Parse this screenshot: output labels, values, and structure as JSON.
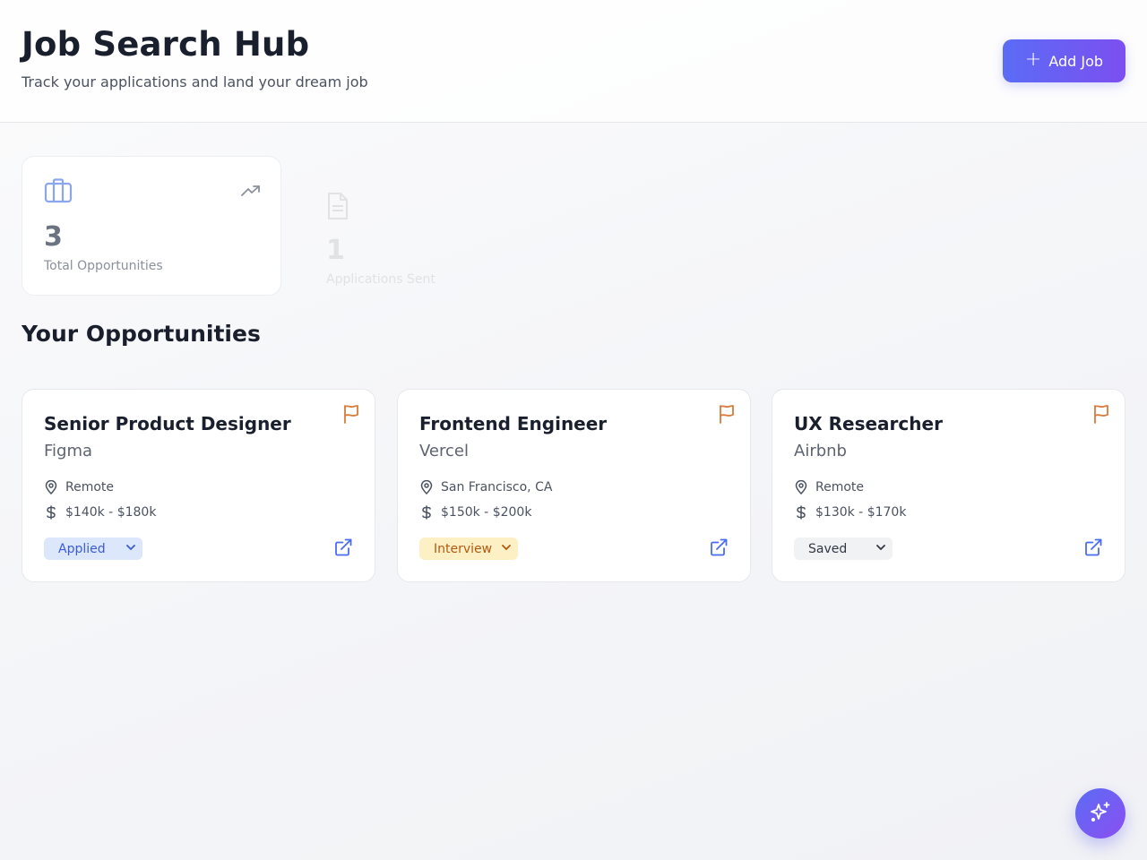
{
  "header": {
    "title": "Job Search Hub",
    "subtitle": "Track your applications and land your dream job",
    "add_button_label": "Add Job",
    "add_button_icon": "plus-icon"
  },
  "stats": [
    {
      "value": "3",
      "label": "Total Opportunities",
      "icon": "briefcase-icon",
      "trend_icon": "trending-up-icon"
    },
    {
      "value": "1",
      "label": "Applications Sent",
      "icon": "file-text-icon"
    }
  ],
  "section": {
    "title": "Your Opportunities"
  },
  "jobs": [
    {
      "title": "Senior Product Designer",
      "company": "Figma",
      "location": "Remote",
      "salary": "$140k - $180k",
      "status": "Applied"
    },
    {
      "title": "Frontend Engineer",
      "company": "Vercel",
      "location": "San Francisco, CA",
      "salary": "$150k - $200k",
      "status": "Interview"
    },
    {
      "title": "UX Researcher",
      "company": "Airbnb",
      "location": "Remote",
      "salary": "$130k - $170k",
      "status": "Saved"
    }
  ],
  "colors": {
    "accent_start": "#5b6cf5",
    "accent_end": "#7c4ff0",
    "flag": "#d97a3a",
    "link": "#4a6cf0",
    "status_applied_bg": "#dde7fb",
    "status_interview_bg": "#fdf0c5",
    "status_saved_bg": "#f1f2f4"
  },
  "fab": {
    "icon": "sparkles-icon"
  }
}
